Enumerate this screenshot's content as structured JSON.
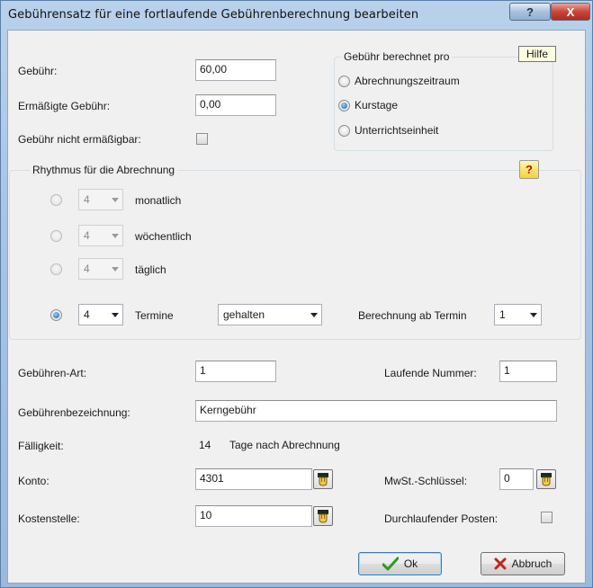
{
  "window": {
    "title": "Gebührensatz für eine fortlaufende Gebührenberechnung bearbeiten",
    "help_button": "?",
    "close_button": "X",
    "tooltip": "Hilfe"
  },
  "fees": {
    "fee_label": "Gebühr:",
    "fee_value": "60,00",
    "reduced_label": "Ermäßigte Gebühr:",
    "reduced_value": "0,00",
    "not_reducible_label": "Gebühr nicht ermäßigbar:",
    "not_reducible_checked": false
  },
  "calc_per": {
    "title": "Gebühr berechnet pro",
    "options": [
      {
        "label": "Abrechnungszeitraum",
        "selected": false
      },
      {
        "label": "Kurstage",
        "selected": true
      },
      {
        "label": "Unterrichtseinheit",
        "selected": false
      }
    ]
  },
  "rhythm": {
    "title": "Rhythmus für die Abrechnung",
    "help_icon": "?",
    "rows": [
      {
        "value": "4",
        "label": "monatlich",
        "selected": false
      },
      {
        "value": "4",
        "label": "wöchentlich",
        "selected": false
      },
      {
        "value": "4",
        "label": "täglich",
        "selected": false
      },
      {
        "value": "4",
        "label": "Termine",
        "selected": true
      }
    ],
    "held_value": "gehalten",
    "start_label": "Berechnung ab Termin",
    "start_value": "1"
  },
  "details": {
    "type_label": "Gebühren-Art:",
    "type_value": "1",
    "seq_label": "Laufende Nummer:",
    "seq_value": "1",
    "desc_label": "Gebührenbezeichnung:",
    "desc_value": "Kerngebühr",
    "due_label": "Fälligkeit:",
    "due_value": "14",
    "due_suffix": "Tage nach Abrechnung",
    "account_label": "Konto:",
    "account_value": "4301",
    "vat_label": "MwSt.-Schlüssel:",
    "vat_value": "0",
    "cost_label": "Kostenstelle:",
    "cost_value": "10",
    "transit_label": "Durchlaufender Posten:",
    "transit_checked": false
  },
  "buttons": {
    "ok": "Ok",
    "cancel": "Abbruch"
  }
}
